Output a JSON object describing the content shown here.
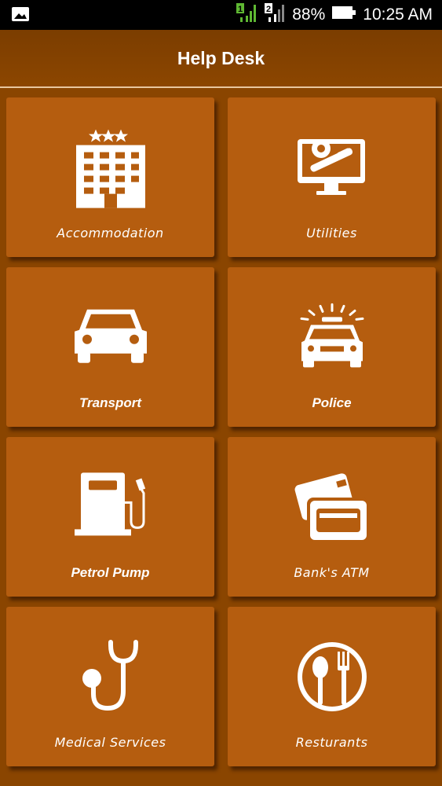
{
  "status_bar": {
    "sim1": "1",
    "sim2": "2",
    "battery": "88%",
    "time": "10:25 AM",
    "icons": [
      "gallery-icon",
      "sim1-signal-icon",
      "sim2-signal-icon",
      "battery-icon"
    ]
  },
  "header": {
    "title": "Help Desk"
  },
  "tiles": [
    {
      "label": "Accommodation",
      "icon": "hotel-icon"
    },
    {
      "label": "Utilities",
      "icon": "monitor-tools-icon"
    },
    {
      "label": "Transport",
      "icon": "car-icon"
    },
    {
      "label": "Police",
      "icon": "police-car-icon"
    },
    {
      "label": "Petrol Pump",
      "icon": "fuel-pump-icon"
    },
    {
      "label": "Bank's ATM",
      "icon": "atm-cards-icon"
    },
    {
      "label": "Medical Services",
      "icon": "stethoscope-icon"
    },
    {
      "label": "Resturants",
      "icon": "restaurant-icon"
    }
  ],
  "colors": {
    "background": "#8a4500",
    "tile": "#b55d0f",
    "header": "#7b3d00"
  }
}
